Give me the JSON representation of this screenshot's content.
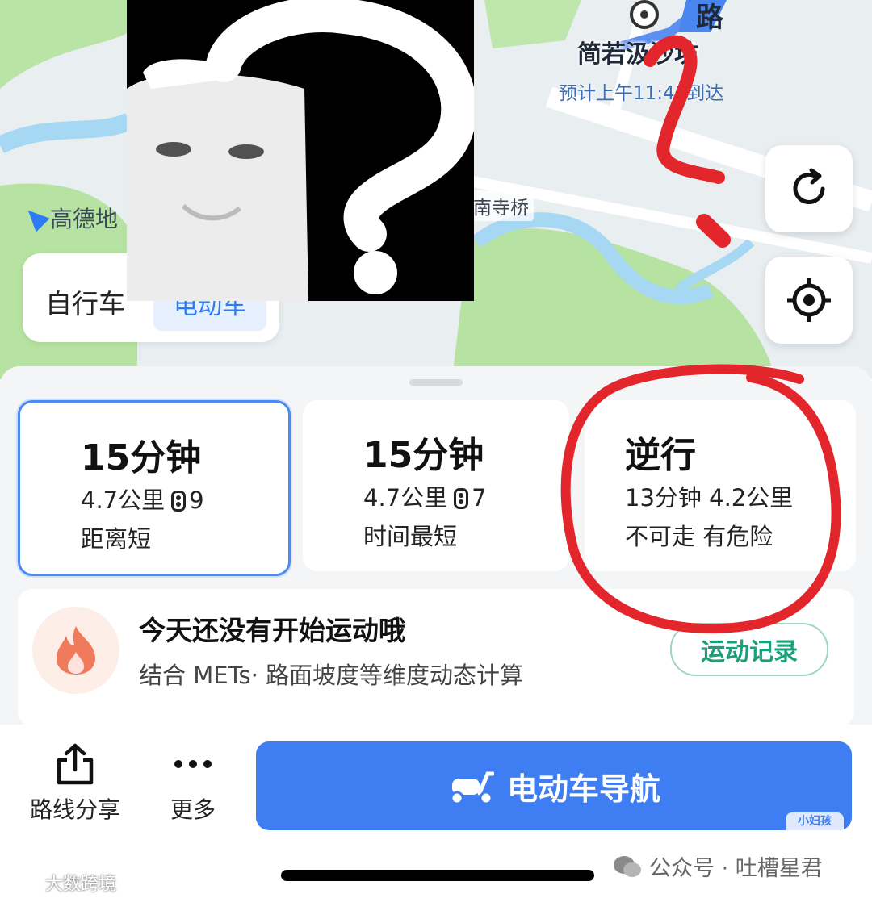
{
  "map": {
    "destination_name": "简若汲沙坊",
    "eta_text": "预计上午11:41到达",
    "road_label": "路",
    "poi_label": "南寺桥",
    "brand_label": "高德地"
  },
  "mode_switch": {
    "bike_label": "自行车",
    "ebike_label": "电动车"
  },
  "routes": [
    {
      "title": "15分钟",
      "distance": "4.7公里",
      "lights": "9",
      "note": "距离短",
      "selected": true
    },
    {
      "title": "15分钟",
      "distance": "4.7公里",
      "lights": "7",
      "note": "时间最短",
      "selected": false
    },
    {
      "title": "逆行",
      "line1": "13分钟 4.2公里",
      "note": "不可走 有危险",
      "selected": false
    }
  ],
  "activity": {
    "title": "今天还没有开始运动哦",
    "subtitle": "结合 METs· 路面坡度等维度动态计算",
    "button": "运动记录"
  },
  "bottom_bar": {
    "share_label": "路线分享",
    "more_label": "更多",
    "nav_label": "电动车导航",
    "nav_corner": "小妇孩"
  },
  "watermarks": {
    "left": "大数跨境",
    "right": "公众号 · 吐槽星君"
  },
  "colors": {
    "accent": "#3f7ef2",
    "selected_border": "#4d8af0",
    "annotation_red": "#e3262b",
    "activity_green": "#1aa07a"
  },
  "icons": {
    "refresh": "refresh-icon",
    "locate": "locate-icon",
    "share": "share-icon",
    "more": "more-icon",
    "fire": "fire-icon",
    "scooter": "scooter-icon"
  }
}
